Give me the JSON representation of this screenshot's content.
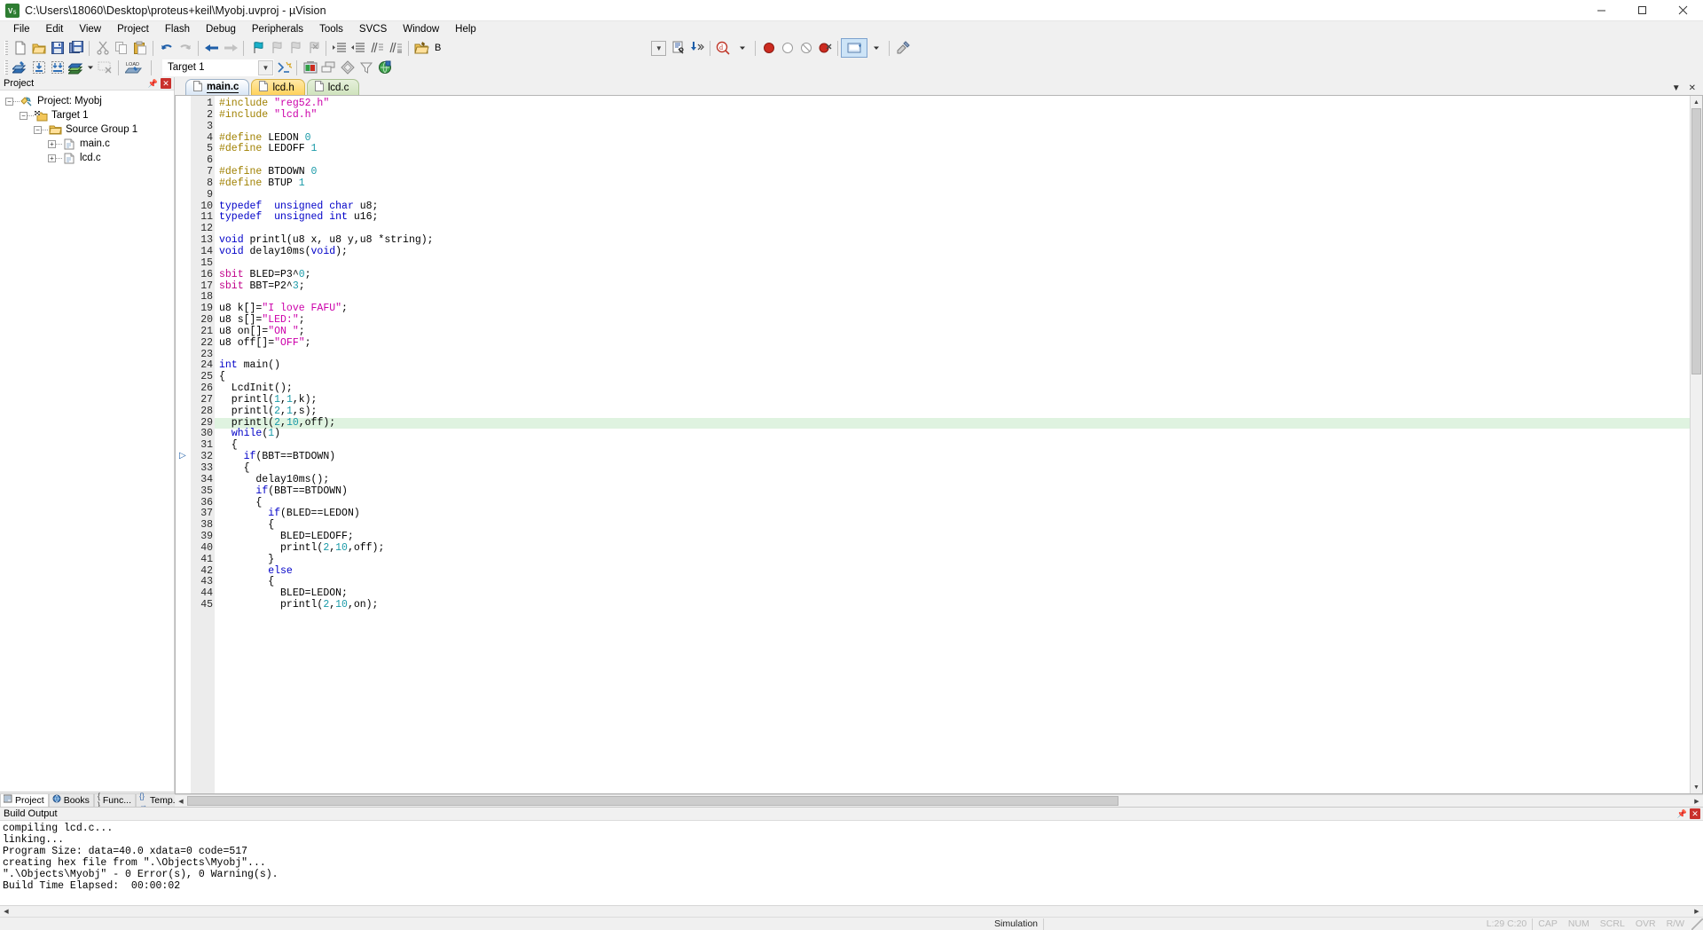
{
  "window": {
    "title": "C:\\Users\\18060\\Desktop\\proteus+keil\\Myobj.uvproj - µVision",
    "app_icon": "keil-uvision-icon",
    "minimize": "–",
    "maximize": "❐",
    "close": "✕"
  },
  "menu": [
    {
      "label": "File"
    },
    {
      "label": "Edit"
    },
    {
      "label": "View"
    },
    {
      "label": "Project"
    },
    {
      "label": "Flash"
    },
    {
      "label": "Debug"
    },
    {
      "label": "Peripherals"
    },
    {
      "label": "Tools"
    },
    {
      "label": "SVCS"
    },
    {
      "label": "Window"
    },
    {
      "label": "Help"
    }
  ],
  "toolbar_main": {
    "buttons": [
      {
        "name": "new-file-icon"
      },
      {
        "name": "open-file-icon"
      },
      {
        "name": "save-icon"
      },
      {
        "name": "save-all-icon"
      },
      {
        "name": "cut-icon"
      },
      {
        "name": "copy-icon"
      },
      {
        "name": "paste-icon"
      },
      {
        "name": "undo-icon"
      },
      {
        "name": "redo-icon"
      },
      {
        "name": "navigate-back-icon"
      },
      {
        "name": "navigate-forward-icon"
      },
      {
        "name": "bookmark-toggle-icon"
      },
      {
        "name": "bookmark-prev-icon"
      },
      {
        "name": "bookmark-next-icon"
      },
      {
        "name": "bookmark-clear-icon"
      },
      {
        "name": "indent-right-icon"
      },
      {
        "name": "indent-left-icon"
      },
      {
        "name": "comment-lines-icon"
      },
      {
        "name": "uncomment-lines-icon"
      },
      {
        "name": "open-folder-find-icon"
      }
    ],
    "b_label": "B",
    "find_combo_value": "",
    "right_buttons": [
      {
        "name": "find-in-files-icon"
      },
      {
        "name": "bookmark-jump-icon"
      },
      {
        "name": "debug-query-icon"
      },
      {
        "name": "dropdown-arrow-icon"
      },
      {
        "name": "insert-breakpoint-icon"
      },
      {
        "name": "disable-breakpoint-icon"
      },
      {
        "name": "disable-all-breakpoints-icon"
      },
      {
        "name": "kill-all-breakpoints-icon"
      },
      {
        "name": "options-target-icon"
      },
      {
        "name": "configure-icon"
      }
    ]
  },
  "toolbar_build": {
    "buttons": [
      {
        "name": "translate-file-icon"
      },
      {
        "name": "build-target-icon"
      },
      {
        "name": "rebuild-all-icon"
      },
      {
        "name": "batch-build-icon"
      },
      {
        "name": "batch-build-dropdown-icon"
      },
      {
        "name": "stop-build-icon"
      },
      {
        "name": "download-load-icon"
      }
    ],
    "target_label": "Target 1",
    "right_buttons": [
      {
        "name": "target-options-icon"
      },
      {
        "name": "manage-components-icon"
      },
      {
        "name": "manage-multi-project-icon"
      },
      {
        "name": "pack-installer-icon"
      },
      {
        "name": "filter-icon"
      },
      {
        "name": "manage-run-environment-icon"
      }
    ]
  },
  "project_pane": {
    "title": "Project",
    "pin_icon": "pin-icon",
    "close_icon": "close-icon",
    "tree": [
      {
        "label": "Project: Myobj",
        "depth": 0,
        "icon": "project-icon",
        "expander": "−"
      },
      {
        "label": "Target 1",
        "depth": 1,
        "icon": "target-icon",
        "expander": "−"
      },
      {
        "label": "Source Group 1",
        "depth": 2,
        "icon": "folder-icon",
        "expander": "−"
      },
      {
        "label": "main.c",
        "depth": 3,
        "icon": "c-file-icon",
        "expander": "+"
      },
      {
        "label": "lcd.c",
        "depth": 3,
        "icon": "c-file-icon",
        "expander": "+"
      }
    ],
    "bottom_tabs": [
      {
        "label": "Project",
        "icon": "project-tab-icon",
        "active": true
      },
      {
        "label": "Books",
        "icon": "books-tab-icon",
        "active": false
      },
      {
        "label": "Func...",
        "icon": "functions-tab-icon",
        "active": false
      },
      {
        "label": "Temp...",
        "icon": "templates-tab-icon",
        "active": false
      }
    ]
  },
  "editor": {
    "tabs": [
      {
        "label": "main.c",
        "kind": "main",
        "active": true,
        "icon": "file-icon"
      },
      {
        "label": "lcd.h",
        "kind": "h",
        "active": false,
        "icon": "file-icon"
      },
      {
        "label": "lcd.c",
        "kind": "c",
        "active": false,
        "icon": "file-icon"
      }
    ],
    "tabstrip_right": [
      {
        "name": "tab-list-dropdown-icon",
        "glyph": "▼"
      },
      {
        "name": "tab-close-icon",
        "glyph": "✕"
      }
    ],
    "first_line": 1,
    "highlight_line": 29,
    "breakpoint_marker_line": 32,
    "lines": [
      {
        "n": 1,
        "tokens": [
          {
            "t": "#include ",
            "c": "pre"
          },
          {
            "t": "\"reg52.h\"",
            "c": "str"
          }
        ]
      },
      {
        "n": 2,
        "tokens": [
          {
            "t": "#include ",
            "c": "pre"
          },
          {
            "t": "\"lcd.h\"",
            "c": "str"
          }
        ]
      },
      {
        "n": 3,
        "tokens": []
      },
      {
        "n": 4,
        "tokens": [
          {
            "t": "#define ",
            "c": "pre"
          },
          {
            "t": "LEDON ",
            "c": ""
          },
          {
            "t": "0",
            "c": "num"
          }
        ]
      },
      {
        "n": 5,
        "tokens": [
          {
            "t": "#define ",
            "c": "pre"
          },
          {
            "t": "LEDOFF ",
            "c": ""
          },
          {
            "t": "1",
            "c": "num"
          }
        ]
      },
      {
        "n": 6,
        "tokens": []
      },
      {
        "n": 7,
        "tokens": [
          {
            "t": "#define ",
            "c": "pre"
          },
          {
            "t": "BTDOWN ",
            "c": ""
          },
          {
            "t": "0",
            "c": "num"
          }
        ]
      },
      {
        "n": 8,
        "tokens": [
          {
            "t": "#define ",
            "c": "pre"
          },
          {
            "t": "BTUP ",
            "c": ""
          },
          {
            "t": "1",
            "c": "num"
          }
        ]
      },
      {
        "n": 9,
        "tokens": []
      },
      {
        "n": 10,
        "tokens": [
          {
            "t": "typedef ",
            "c": "kw"
          },
          {
            "t": " ",
            "c": ""
          },
          {
            "t": "unsigned char",
            "c": "kw"
          },
          {
            "t": " u8;",
            "c": ""
          }
        ]
      },
      {
        "n": 11,
        "tokens": [
          {
            "t": "typedef ",
            "c": "kw"
          },
          {
            "t": " ",
            "c": ""
          },
          {
            "t": "unsigned int",
            "c": "kw"
          },
          {
            "t": " u16;",
            "c": ""
          }
        ]
      },
      {
        "n": 12,
        "tokens": []
      },
      {
        "n": 13,
        "tokens": [
          {
            "t": "void",
            "c": "kw"
          },
          {
            "t": " printl(u8 x, u8 y,u8 *string);",
            "c": ""
          }
        ]
      },
      {
        "n": 14,
        "tokens": [
          {
            "t": "void",
            "c": "kw"
          },
          {
            "t": " delay10ms(",
            "c": ""
          },
          {
            "t": "void",
            "c": "kw"
          },
          {
            "t": ");",
            "c": ""
          }
        ]
      },
      {
        "n": 15,
        "tokens": []
      },
      {
        "n": 16,
        "tokens": [
          {
            "t": "sbit",
            "c": "kw2"
          },
          {
            "t": " BLED=P3^",
            "c": ""
          },
          {
            "t": "0",
            "c": "num"
          },
          {
            "t": ";",
            "c": ""
          }
        ]
      },
      {
        "n": 17,
        "tokens": [
          {
            "t": "sbit",
            "c": "kw2"
          },
          {
            "t": " BBT=P2^",
            "c": ""
          },
          {
            "t": "3",
            "c": "num"
          },
          {
            "t": ";",
            "c": ""
          }
        ]
      },
      {
        "n": 18,
        "tokens": []
      },
      {
        "n": 19,
        "tokens": [
          {
            "t": "u8 k[]=",
            "c": ""
          },
          {
            "t": "\"I love FAFU\"",
            "c": "str"
          },
          {
            "t": ";",
            "c": ""
          }
        ]
      },
      {
        "n": 20,
        "tokens": [
          {
            "t": "u8 s[]=",
            "c": ""
          },
          {
            "t": "\"LED:\"",
            "c": "str"
          },
          {
            "t": ";",
            "c": ""
          }
        ]
      },
      {
        "n": 21,
        "tokens": [
          {
            "t": "u8 on[]=",
            "c": ""
          },
          {
            "t": "\"ON \"",
            "c": "str"
          },
          {
            "t": ";",
            "c": ""
          }
        ]
      },
      {
        "n": 22,
        "tokens": [
          {
            "t": "u8 off[]=",
            "c": ""
          },
          {
            "t": "\"OFF\"",
            "c": "str"
          },
          {
            "t": ";",
            "c": ""
          }
        ]
      },
      {
        "n": 23,
        "tokens": []
      },
      {
        "n": 24,
        "tokens": [
          {
            "t": "int",
            "c": "kw"
          },
          {
            "t": " main()",
            "c": ""
          }
        ]
      },
      {
        "n": 25,
        "tokens": [
          {
            "t": "{",
            "c": ""
          }
        ]
      },
      {
        "n": 26,
        "tokens": [
          {
            "t": "  LcdInit();",
            "c": ""
          }
        ]
      },
      {
        "n": 27,
        "tokens": [
          {
            "t": "  printl(",
            "c": ""
          },
          {
            "t": "1",
            "c": "num"
          },
          {
            "t": ",",
            "c": ""
          },
          {
            "t": "1",
            "c": "num"
          },
          {
            "t": ",k);",
            "c": ""
          }
        ]
      },
      {
        "n": 28,
        "tokens": [
          {
            "t": "  printl(",
            "c": ""
          },
          {
            "t": "2",
            "c": "num"
          },
          {
            "t": ",",
            "c": ""
          },
          {
            "t": "1",
            "c": "num"
          },
          {
            "t": ",s);",
            "c": ""
          }
        ]
      },
      {
        "n": 29,
        "tokens": [
          {
            "t": "  printl(",
            "c": ""
          },
          {
            "t": "2",
            "c": "num"
          },
          {
            "t": ",",
            "c": ""
          },
          {
            "t": "10",
            "c": "num"
          },
          {
            "t": ",off);",
            "c": ""
          }
        ]
      },
      {
        "n": 30,
        "tokens": [
          {
            "t": "  ",
            "c": ""
          },
          {
            "t": "while",
            "c": "kw"
          },
          {
            "t": "(",
            "c": ""
          },
          {
            "t": "1",
            "c": "num"
          },
          {
            "t": ")",
            "c": ""
          }
        ]
      },
      {
        "n": 31,
        "tokens": [
          {
            "t": "  {",
            "c": ""
          }
        ]
      },
      {
        "n": 32,
        "tokens": [
          {
            "t": "    ",
            "c": ""
          },
          {
            "t": "if",
            "c": "kw"
          },
          {
            "t": "(BBT==BTDOWN)",
            "c": ""
          }
        ]
      },
      {
        "n": 33,
        "tokens": [
          {
            "t": "    {",
            "c": ""
          }
        ]
      },
      {
        "n": 34,
        "tokens": [
          {
            "t": "      delay10ms();",
            "c": ""
          }
        ]
      },
      {
        "n": 35,
        "tokens": [
          {
            "t": "      ",
            "c": ""
          },
          {
            "t": "if",
            "c": "kw"
          },
          {
            "t": "(BBT==BTDOWN)",
            "c": ""
          }
        ]
      },
      {
        "n": 36,
        "tokens": [
          {
            "t": "      {",
            "c": ""
          }
        ]
      },
      {
        "n": 37,
        "tokens": [
          {
            "t": "        ",
            "c": ""
          },
          {
            "t": "if",
            "c": "kw"
          },
          {
            "t": "(BLED==LEDON)",
            "c": ""
          }
        ]
      },
      {
        "n": 38,
        "tokens": [
          {
            "t": "        {",
            "c": ""
          }
        ]
      },
      {
        "n": 39,
        "tokens": [
          {
            "t": "          BLED=LEDOFF;",
            "c": ""
          }
        ]
      },
      {
        "n": 40,
        "tokens": [
          {
            "t": "          printl(",
            "c": ""
          },
          {
            "t": "2",
            "c": "num"
          },
          {
            "t": ",",
            "c": ""
          },
          {
            "t": "10",
            "c": "num"
          },
          {
            "t": ",off);",
            "c": ""
          }
        ]
      },
      {
        "n": 41,
        "tokens": [
          {
            "t": "        }",
            "c": ""
          }
        ]
      },
      {
        "n": 42,
        "tokens": [
          {
            "t": "        ",
            "c": ""
          },
          {
            "t": "else",
            "c": "kw"
          }
        ]
      },
      {
        "n": 43,
        "tokens": [
          {
            "t": "        {",
            "c": ""
          }
        ]
      },
      {
        "n": 44,
        "tokens": [
          {
            "t": "          BLED=LEDON;",
            "c": ""
          }
        ]
      },
      {
        "n": 45,
        "tokens": [
          {
            "t": "          printl(",
            "c": ""
          },
          {
            "t": "2",
            "c": "num"
          },
          {
            "t": ",",
            "c": ""
          },
          {
            "t": "10",
            "c": "num"
          },
          {
            "t": ",on);",
            "c": ""
          }
        ]
      }
    ]
  },
  "build_output": {
    "title": "Build Output",
    "pin_icon": "pin-icon",
    "close_icon": "close-icon",
    "lines": [
      "compiling lcd.c...",
      "linking...",
      "Program Size: data=40.0 xdata=0 code=517",
      "creating hex file from \".\\Objects\\Myobj\"...",
      "\".\\Objects\\Myobj\" - 0 Error(s), 0 Warning(s).",
      "Build Time Elapsed:  00:00:02"
    ]
  },
  "statusbar": {
    "simulation": "Simulation",
    "cursor": "L:29 C:20",
    "indicators": [
      "CAP",
      "NUM",
      "SCRL",
      "OVR",
      "R/W"
    ]
  },
  "colors": {
    "accent_blue": "#0000c8",
    "string_magenta": "#cc00aa",
    "preproc_olive": "#a08000",
    "number_teal": "#1a9aa8",
    "sbit_pink": "#c1008a",
    "highlight_green": "#dff3e0",
    "close_red": "#c9302c"
  }
}
